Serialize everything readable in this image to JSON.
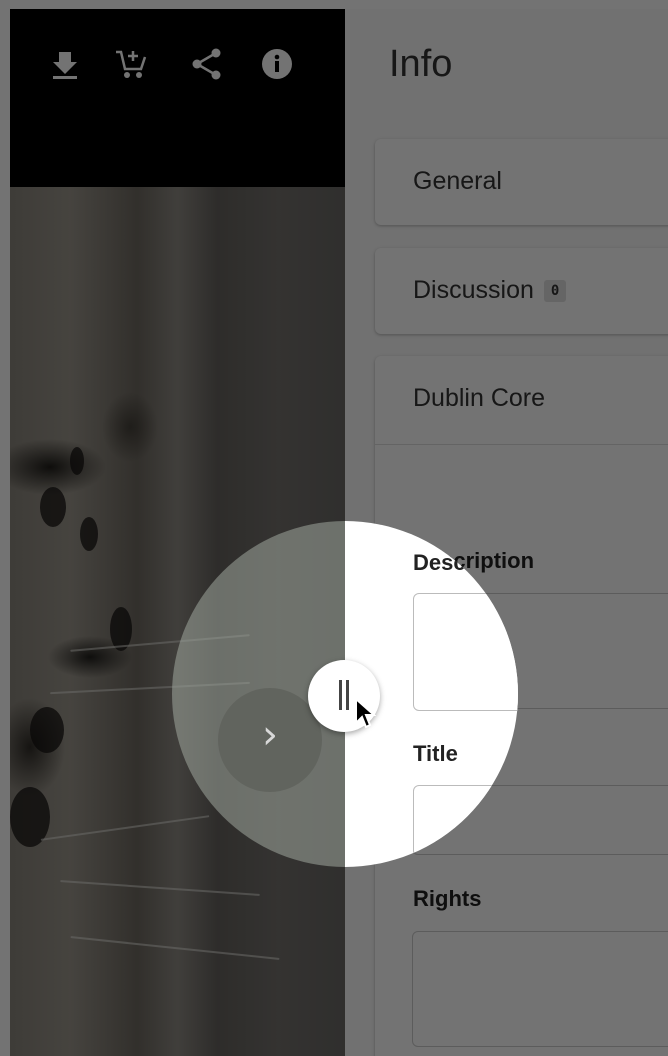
{
  "toolbar": {
    "icons": [
      "download-icon",
      "add-to-cart-icon",
      "share-icon",
      "info-icon"
    ]
  },
  "panel": {
    "title": "Info",
    "sections": {
      "general": "General",
      "discussion": "Discussion",
      "discussion_count": "0",
      "dublin_core": "Dublin Core"
    },
    "fields": {
      "description": "Description",
      "title": "Title",
      "rights": "Rights"
    }
  },
  "navigation": {
    "next_glyph": "›"
  },
  "colors": {
    "overlay": "#000000",
    "panel_bg": "#fafafa",
    "badge_bg": "#e0e0e0"
  }
}
